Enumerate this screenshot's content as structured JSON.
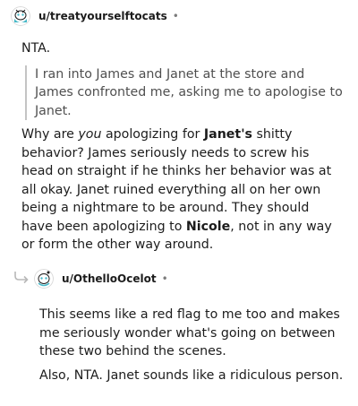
{
  "top_comment": {
    "username": "u/treatyourselftocats",
    "dot": "•",
    "verdict": "NTA.",
    "quote": "I ran into James and Janet at the store and James confronted me, asking me to apologise to Janet.",
    "body_parts": {
      "p1_a": "Why are ",
      "p1_em": "you",
      "p1_b": " apologizing for ",
      "p1_strong1": "Janet's",
      "p1_c": " shitty behavior? James seriously needs to screw his head on straight if he thinks her behavior was at all okay. Janet ruined everything all on her own being a nightmare to be around. They should have been apologizing to ",
      "p1_strong2": "Nicole",
      "p1_d": ", not in any way or form the other way around."
    }
  },
  "reply_comment": {
    "username": "u/OthelloOcelot",
    "dot": "•",
    "paragraph1": "This seems like a red flag to me too and makes me seriously wonder what's going on between these two behind the scenes.",
    "paragraph2": "Also, NTA. Janet sounds like a ridiculous person."
  },
  "icons": {
    "avatar1": "snoo-avatar-icon",
    "avatar2": "snoo-avatar-icon",
    "reply": "reply-arrow-icon"
  },
  "colors": {
    "text": "#1c1c1c",
    "quote_text": "#4f4f4f",
    "quote_bar": "#c4c4c4",
    "meta": "#7c7c7c",
    "avatar_teal": "#46b8c8"
  }
}
